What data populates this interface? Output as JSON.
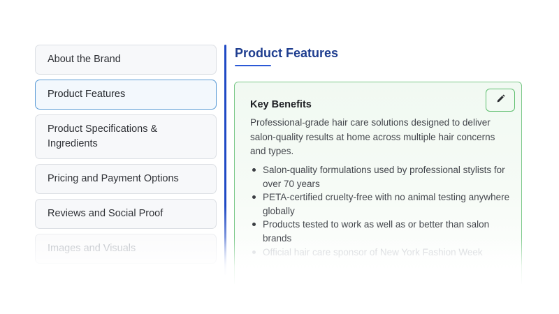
{
  "sidebar": {
    "items": [
      {
        "label": "About the Brand"
      },
      {
        "label": "Product Features"
      },
      {
        "label": "Product Specifications & Ingredients"
      },
      {
        "label": "Pricing and Payment Options"
      },
      {
        "label": "Reviews and Social Proof"
      },
      {
        "label": "Images and Visuals"
      }
    ],
    "active_item": "Product Features"
  },
  "main": {
    "section_title": "Product Features",
    "card": {
      "heading": "Key Benefits",
      "description": "Professional-grade hair care solutions designed to deliver salon-quality results at home across multiple hair concerns and types.",
      "benefits": [
        "Salon-quality formulations used by professional stylists for over 70 years",
        "PETA-certified cruelty-free with no animal testing anywhere globally",
        "Products tested to work as well as or better than salon brands",
        "Official hair care sponsor of New York Fashion Week"
      ],
      "edit_icon": "pencil-icon"
    }
  },
  "colors": {
    "accent_blue": "#1f49c4",
    "title_blue": "#1e3d8f",
    "active_border": "#5a9bd6",
    "card_border_green": "#7cc98a",
    "card_background": "#f1f9f2"
  }
}
